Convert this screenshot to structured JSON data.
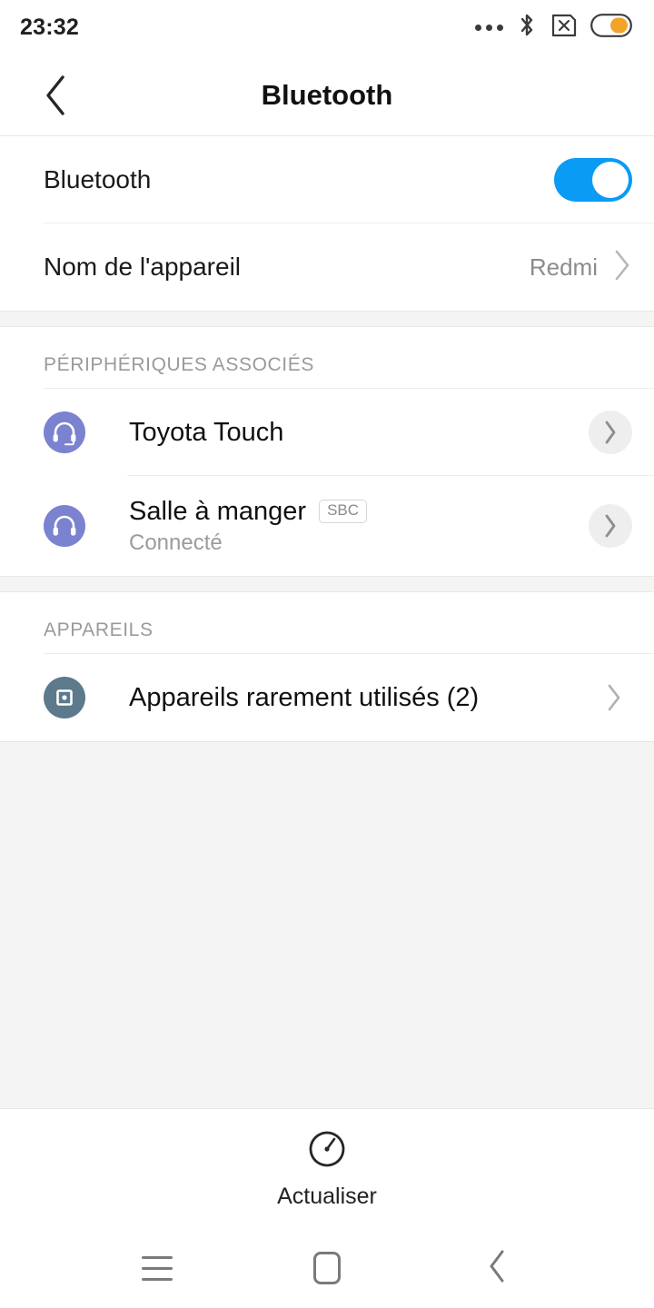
{
  "statusbar": {
    "time": "23:32",
    "icons": [
      {
        "name": "more-dots-icon",
        "label": "..."
      },
      {
        "name": "bluetooth-icon",
        "label": "bluetooth"
      },
      {
        "name": "sim-card-missing-icon",
        "label": "no-sim"
      },
      {
        "name": "battery-icon",
        "label": "battery"
      }
    ],
    "battery_fill_color": "#f2a32a",
    "bluetooth_color": "#f2a32a"
  },
  "titlebar": {
    "title": "Bluetooth",
    "back_icon": "back-chevron-icon"
  },
  "settings": {
    "bluetooth_toggle": {
      "label": "Bluetooth",
      "state": "on",
      "on_color": "#0a9bf5"
    },
    "device_name": {
      "label": "Nom de l'appareil",
      "value": "Redmi",
      "chevron": "chevron-right-icon"
    }
  },
  "paired_section": {
    "header": "PÉRIPHÉRIQUES ASSOCIÉS",
    "devices": [
      {
        "name": "Toyota Touch",
        "subtitle": "",
        "codec": "",
        "icon": "headset-icon",
        "icon_color": "#7b82cf",
        "action_icon": "chevron-right-circle-icon"
      },
      {
        "name": "Salle à manger",
        "subtitle": "Connecté",
        "codec": "SBC",
        "icon": "headphones-icon",
        "icon_color": "#7b82cf",
        "action_icon": "chevron-right-circle-icon"
      }
    ]
  },
  "devices_section": {
    "header": "APPAREILS",
    "items": [
      {
        "label": "Appareils rarement utilisés (2)",
        "icon": "generic-device-icon",
        "icon_color": "#5c7a8c",
        "action_icon": "chevron-right-icon"
      }
    ]
  },
  "refresh": {
    "label": "Actualiser",
    "icon": "refresh-timer-icon"
  },
  "navbar": {
    "buttons": [
      {
        "name": "recents-button",
        "icon": "hamburger-icon"
      },
      {
        "name": "home-button",
        "icon": "home-square-icon"
      },
      {
        "name": "back-button",
        "icon": "back-chevron-icon"
      }
    ]
  }
}
